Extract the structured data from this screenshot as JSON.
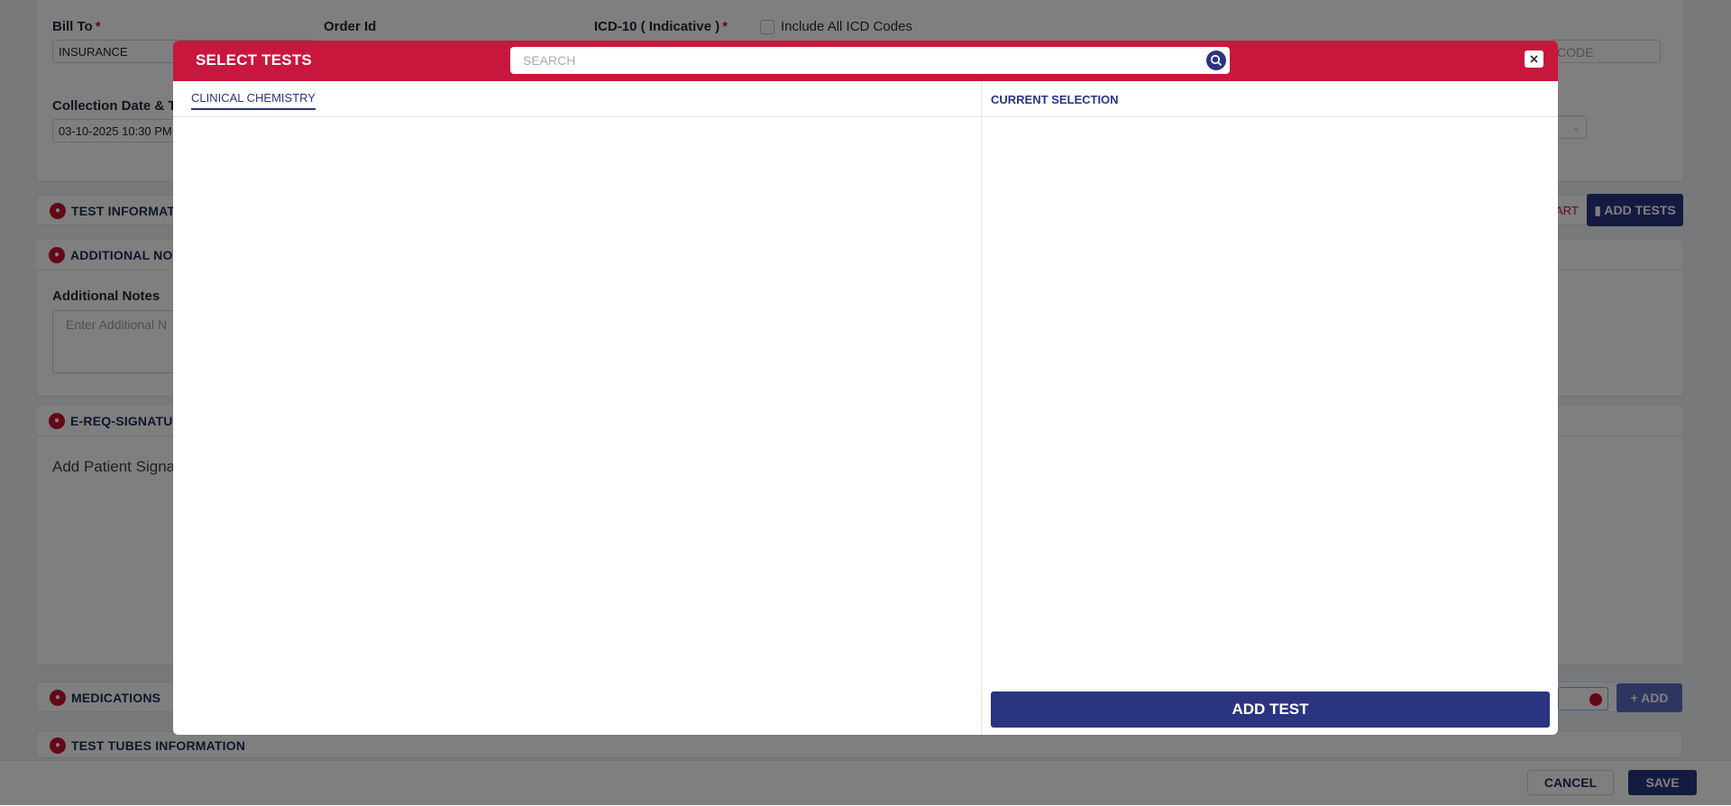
{
  "form": {
    "bill_to_label": "Bill To",
    "required_mark": "*",
    "bill_to_value": "INSURANCE",
    "order_id_label": "Order Id",
    "icd_label": "ICD-10 ( Indicative )",
    "include_icd_label": "Include All ICD Codes",
    "code_placeholder": "CODE",
    "collection_label": "Collection Date & T",
    "collection_value": "03-10-2025 10:30 PM"
  },
  "sections": {
    "test_information": "TEST INFORMATI",
    "cart_text": "ART",
    "add_tests_label": "ADD TESTS",
    "additional_notes": "ADDITIONAL NOT",
    "additional_notes_label": "Additional Notes",
    "additional_notes_placeholder": "Enter Additional N",
    "ereq_signature": "E-REQ-SIGNATU",
    "add_patient_signature": "Add Patient Signa",
    "medications": "MEDICATIONS",
    "add_label": "+ ADD",
    "test_tubes": "TEST TUBES INFORMATION"
  },
  "footer": {
    "cancel_label": "CANCEL",
    "save_label": "SAVE"
  },
  "modal": {
    "title": "SELECT TESTS",
    "search_placeholder": "SEARCH",
    "search_icon": "search-icon",
    "close_icon": "close-icon",
    "tabs": [
      {
        "label": "CLINICAL CHEMISTRY",
        "active": true
      }
    ],
    "current_selection_title": "CURRENT SELECTION",
    "add_test_label": "ADD TEST"
  },
  "colors": {
    "header_red": "#c8173d",
    "navy": "#2a3480"
  }
}
